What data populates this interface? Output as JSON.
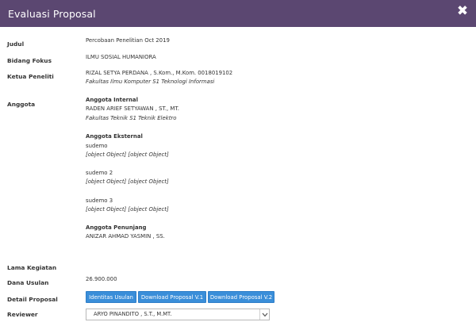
{
  "modal": {
    "title": "Evaluasi Proposal",
    "close_icon": "close-icon"
  },
  "fields": {
    "judul_label": "Judul",
    "judul_value": "Percobaan Penelitian Oct 2019",
    "bidang_label": "Bidang Fokus",
    "bidang_value": "ILMU SOSIAL HUMANIORA",
    "ketua_label": "Ketua Peneliti",
    "ketua_name": "RIZAL SETYA PERDANA , S.Kom., M.Kom. 0018019102",
    "ketua_unit": "Fakultas Ilmu Komputer S1 Teknologi Informasi",
    "anggota_label": "Anggota",
    "internal_heading": "Anggota Internal",
    "internal_name": "RADEN ARIEF SETYAWAN , ST., MT.",
    "internal_unit": "Fakultas Teknik S1 Teknik Elektro",
    "eksternal_heading": "Anggota Eksternal",
    "eksternal": [
      {
        "name": "sudemo",
        "detail": "[object Object] [object Object]"
      },
      {
        "name": "sudemo 2",
        "detail": "[object Object] [object Object]"
      },
      {
        "name": "sudemo 3",
        "detail": "[object Object] [object Object]"
      }
    ],
    "penunjang_heading": "Anggota Penunjang",
    "penunjang_name": "ANIZAR AHMAD YASMIN , SS.",
    "lama_label": "Lama Kegiatan",
    "dana_label": "Dana Usulan",
    "dana_value": "26.900.000",
    "detail_label": "Detail Proposal",
    "reviewer_label": "Reviewer"
  },
  "buttons": {
    "identitas": "Identitas Usulan",
    "download_v1": "Download Proposal V.1",
    "download_v2": "Download Proposal V.2"
  },
  "reviewer_select": {
    "selected": "ARYO PINANDITO , S.T., M.MT."
  }
}
